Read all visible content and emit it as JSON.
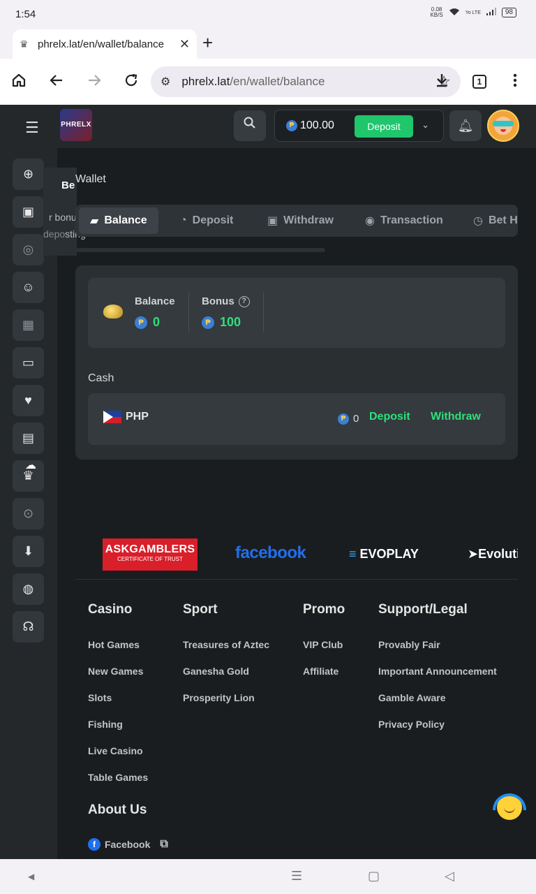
{
  "status_bar": {
    "time": "1:54",
    "net_speed": "0.08",
    "net_unit": "KB/S",
    "battery": "98",
    "signal_label": "Yo LTE"
  },
  "browser": {
    "tab_title": "phrelx.lat/en/wallet/balance",
    "url_host": "phrelx.lat",
    "url_path": "/en/wallet/balance",
    "tab_count": "1"
  },
  "header": {
    "logo_text": "PHRELX",
    "balance": "100.00",
    "deposit_label": "Deposit",
    "coin_symbol": "₱"
  },
  "rail_popup": {
    "title": "Be",
    "line1": "r bonu",
    "line2_dim": "depo",
    "line2": "sting"
  },
  "wallet": {
    "page_title": "Wallet",
    "tabs": [
      {
        "label": "Balance",
        "icon": "wallet-icon"
      },
      {
        "label": "Deposit",
        "icon": "piggy-bank-icon"
      },
      {
        "label": "Withdraw",
        "icon": "atm-icon"
      },
      {
        "label": "Transaction",
        "icon": "coin-stack-icon"
      },
      {
        "label": "Bet H",
        "icon": "clock-icon"
      }
    ],
    "balance_label": "Balance",
    "balance_value": "0",
    "bonus_label": "Bonus",
    "bonus_value": "100",
    "cash_label": "Cash",
    "currency_code": "PHP",
    "currency_amount": "0",
    "deposit_link": "Deposit",
    "withdraw_link": "Withdraw"
  },
  "footer": {
    "partners": {
      "ask_title": "ASKGAMBLERS",
      "ask_sub": "CERTIFICATE OF TRUST",
      "facebook": "facebook",
      "evoplay": "EVOPLAY",
      "evolution": "Evoluti"
    },
    "columns": [
      {
        "heading": "Casino",
        "links": [
          "Hot Games",
          "New Games",
          "Slots",
          "Fishing",
          "Live Casino",
          "Table Games"
        ]
      },
      {
        "heading": "Sport",
        "links": [
          "Treasures of Aztec",
          "Ganesha Gold",
          "Prosperity Lion"
        ]
      },
      {
        "heading": "Promo",
        "links": [
          "VIP Club",
          "Affiliate"
        ]
      },
      {
        "heading": "Support/Legal",
        "links": [
          "Provably Fair",
          "Important Announcement",
          "Gamble Aware",
          "Privacy Policy"
        ]
      }
    ],
    "about_heading": "About Us",
    "facebook_link": "Facebook"
  }
}
